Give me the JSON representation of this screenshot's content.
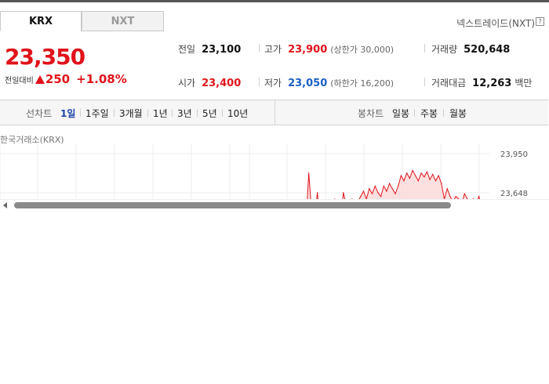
{
  "tabs": [
    {
      "label": "KRX",
      "active": true
    },
    {
      "label": "NXT",
      "active": false
    }
  ],
  "nxt_link": "넥스트레이드(NXT)",
  "help_icon": "?",
  "price": {
    "current": "23,350",
    "change_label": "전일대비",
    "change_value": "250",
    "change_pct": "+1.08%",
    "direction": "up",
    "color_up": "#e0131a",
    "color_down": "#1a5fc4"
  },
  "stats": {
    "prev_close": {
      "label": "전일",
      "value": "23,100"
    },
    "high": {
      "label": "고가",
      "value": "23,900",
      "sub": "(상한가 30,000)"
    },
    "volume": {
      "label": "거래량",
      "value": "520,648"
    },
    "open": {
      "label": "시가",
      "value": "23,400"
    },
    "low": {
      "label": "저가",
      "value": "23,050",
      "sub": "(하한가 16,200)"
    },
    "amount": {
      "label": "거래대금",
      "value": "12,263",
      "unit": "백만"
    }
  },
  "period_bar": {
    "line_chart_label": "선차트",
    "line_periods": [
      "1일",
      "1주일",
      "3개월",
      "1년",
      "3년",
      "5년",
      "10년"
    ],
    "selected_period": "1일",
    "candle_chart_label": "봉차트",
    "candle_periods": [
      "일봉",
      "주봉",
      "월봉"
    ]
  },
  "exchange_label": "한국거래소(KRX)",
  "chart_data": {
    "type": "area",
    "title": "",
    "ylim": [
      23300,
      23950
    ],
    "y_tick_labels": [
      "23,950",
      "23,648"
    ],
    "y_ticks": [
      23950,
      23648
    ],
    "y": [
      23400,
      23800,
      23500,
      23450,
      23650,
      23400,
      23500,
      23380,
      23550,
      23450,
      23600,
      23500,
      23420,
      23650,
      23550,
      23500,
      23600,
      23520,
      23580,
      23620,
      23660,
      23600,
      23680,
      23640,
      23700,
      23650,
      23620,
      23700,
      23660,
      23720,
      23680,
      23640,
      23700,
      23780,
      23740,
      23800,
      23760,
      23820,
      23780,
      23740,
      23800,
      23770,
      23810,
      23750,
      23790,
      23740,
      23780,
      23720,
      23600,
      23680,
      23620,
      23580,
      23620,
      23600,
      23560,
      23640,
      23600,
      23520,
      23600,
      23560,
      23620,
      23540,
      23500
    ],
    "grid": true,
    "color": "#e0131a"
  }
}
